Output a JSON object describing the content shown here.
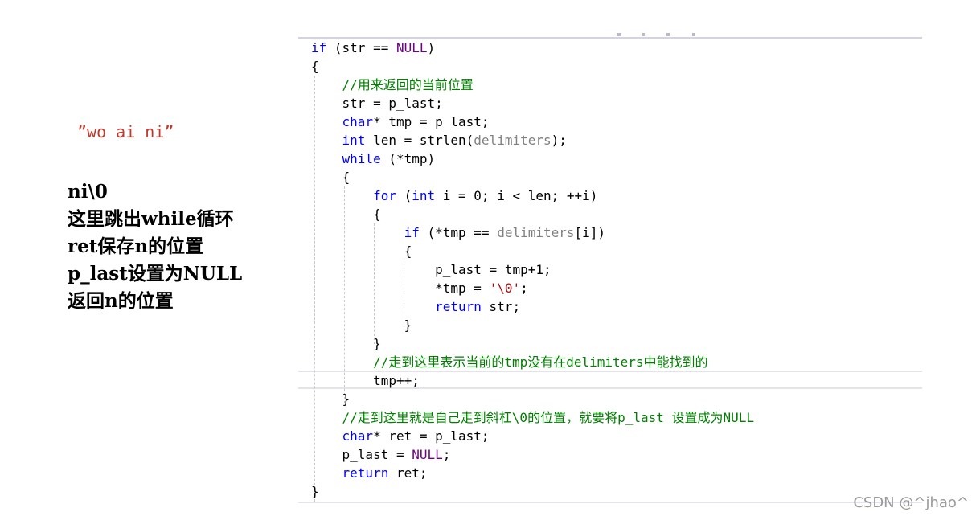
{
  "annotation": {
    "quote": "”wo ai ni”",
    "lines": [
      "ni\\0",
      "这里跳出while循环",
      "ret保存n的位置",
      "p_last设置为NULL",
      "返回n的位置"
    ]
  },
  "editor": {
    "colors": {
      "keyword": "#0000ff",
      "comment": "#008000",
      "macro": "#6f008a",
      "parameter": "#808080",
      "string": "#a31515"
    },
    "code": [
      [
        [
          "kw",
          "if"
        ],
        [
          "t",
          " (str == "
        ],
        [
          "mac",
          "NULL"
        ],
        [
          "t",
          ")"
        ]
      ],
      [
        [
          "t",
          "{"
        ]
      ],
      [
        [
          "cm",
          "    //用来返回的当前位置"
        ]
      ],
      [
        [
          "t",
          "    str = p_last;"
        ]
      ],
      [
        [
          "t",
          "    "
        ],
        [
          "kw",
          "char"
        ],
        [
          "t",
          "* tmp = p_last;"
        ]
      ],
      [
        [
          "t",
          "    "
        ],
        [
          "kw",
          "int"
        ],
        [
          "t",
          " len = strlen("
        ],
        [
          "prm",
          "delimiters"
        ],
        [
          "t",
          ");"
        ]
      ],
      [
        [
          "t",
          "    "
        ],
        [
          "kw",
          "while"
        ],
        [
          "t",
          " (*tmp)"
        ]
      ],
      [
        [
          "t",
          "    {"
        ]
      ],
      [
        [
          "t",
          "        "
        ],
        [
          "kw",
          "for"
        ],
        [
          "t",
          " ("
        ],
        [
          "kw",
          "int"
        ],
        [
          "t",
          " i = 0; i < len; ++i)"
        ]
      ],
      [
        [
          "t",
          "        {"
        ]
      ],
      [
        [
          "t",
          "            "
        ],
        [
          "kw",
          "if"
        ],
        [
          "t",
          " (*tmp == "
        ],
        [
          "prm",
          "delimiters"
        ],
        [
          "t",
          "[i])"
        ]
      ],
      [
        [
          "t",
          "            {"
        ]
      ],
      [
        [
          "t",
          "                p_last = tmp+1;"
        ]
      ],
      [
        [
          "t",
          "                *tmp = "
        ],
        [
          "str",
          "'\\0'"
        ],
        [
          "t",
          ";"
        ]
      ],
      [
        [
          "t",
          "                "
        ],
        [
          "kw",
          "return"
        ],
        [
          "t",
          " str;"
        ]
      ],
      [
        [
          "t",
          "            }"
        ]
      ],
      [
        [
          "t",
          "        }"
        ]
      ],
      [
        [
          "cm",
          "        //走到这里表示当前的tmp没有在delimiters中能找到的"
        ]
      ],
      [
        [
          "t",
          "        tmp++;"
        ],
        [
          "caret",
          ""
        ]
      ],
      [
        [
          "t",
          "    }"
        ]
      ],
      [
        [
          "cm",
          "    //走到这里就是自己走到斜杠\\0的位置，就要将p_last 设置成为NULL"
        ]
      ],
      [
        [
          "t",
          "    "
        ],
        [
          "kw",
          "char"
        ],
        [
          "t",
          "* ret = p_last;"
        ]
      ],
      [
        [
          "t",
          "    p_last = "
        ],
        [
          "mac",
          "NULL"
        ],
        [
          "t",
          ";"
        ]
      ],
      [
        [
          "t",
          "    "
        ],
        [
          "kw",
          "return"
        ],
        [
          "t",
          " ret;"
        ]
      ],
      [
        [
          "t",
          "}"
        ]
      ]
    ]
  },
  "watermark": "CSDN @^jhao^"
}
